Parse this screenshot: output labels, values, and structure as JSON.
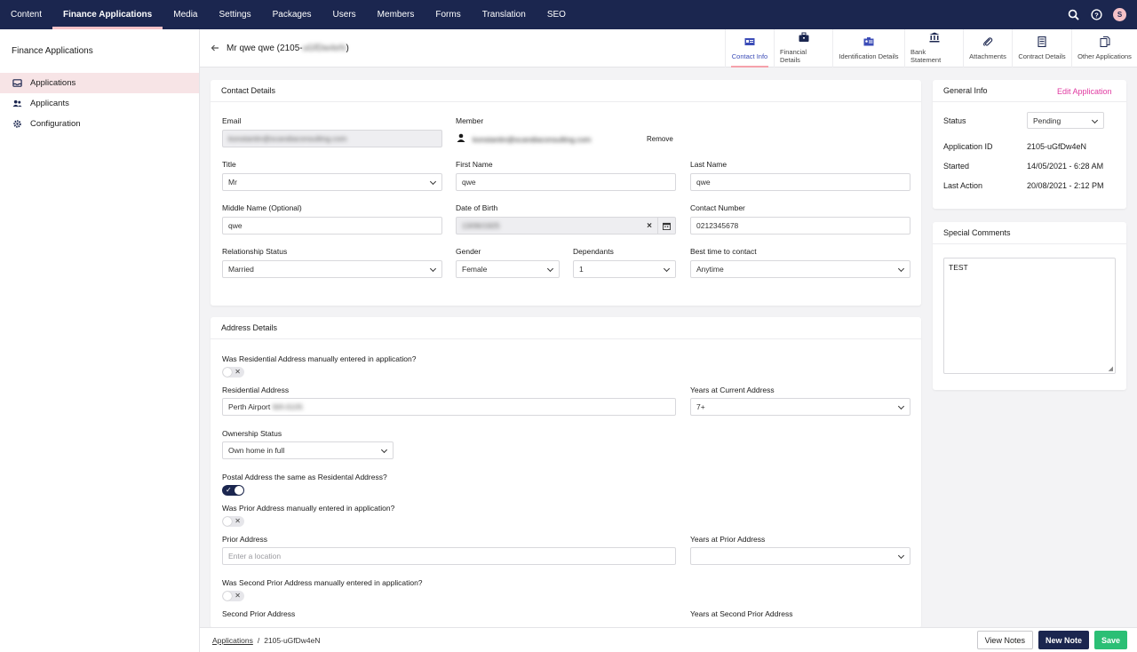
{
  "nav": {
    "tabs": [
      "Content",
      "Finance Applications",
      "Media",
      "Settings",
      "Packages",
      "Users",
      "Members",
      "Forms",
      "Translation",
      "SEO"
    ],
    "avatar": "S"
  },
  "sidebar": {
    "title": "Finance Applications",
    "items": [
      "Applications",
      "Applicants",
      "Configuration"
    ]
  },
  "header": {
    "title": "Mr qwe qwe (2105-",
    "title_blurred": "uGfDw4eN",
    "title_end": ")",
    "tabs": [
      "Contact Info",
      "Financial Details",
      "Identification Details",
      "Bank Statement",
      "Attachments",
      "Contract Details",
      "Other Applications"
    ]
  },
  "contact": {
    "heading": "Contact Details",
    "email_label": "Email",
    "email_value": "konstantin@scandiaconsulting.com",
    "member_label": "Member",
    "member_value": "konstantin@scandiaconsulting.com",
    "remove": "Remove",
    "title_label": "Title",
    "title_value": "Mr",
    "first_label": "First Name",
    "first_value": "qwe",
    "last_label": "Last Name",
    "last_value": "qwe",
    "middle_label": "Middle Name (Optional)",
    "middle_value": "qwe",
    "dob_label": "Date of Birth",
    "dob_value": "13/06/1925",
    "contact_label": "Contact Number",
    "contact_value": "0212345678",
    "rel_label": "Relationship Status",
    "rel_value": "Married",
    "gender_label": "Gender",
    "gender_value": "Female",
    "dep_label": "Dependants",
    "dep_value": "1",
    "best_label": "Best time to contact",
    "best_value": "Anytime"
  },
  "address": {
    "heading": "Address Details",
    "res_manual_label": "Was Residential Address manually entered in application?",
    "res_label": "Residential Address",
    "res_value": "Perth Airport",
    "res_value_blurred": "WA 6105",
    "years_cur_label": "Years at Current Address",
    "years_cur_value": "7+",
    "own_label": "Ownership Status",
    "own_value": "Own home in full",
    "postal_label": "Postal Address the same as Residental Address?",
    "prior_manual_label": "Was Prior Address manually entered in application?",
    "prior_label": "Prior Address",
    "prior_placeholder": "Enter a location",
    "years_prior_label": "Years at Prior Address",
    "second_manual_label": "Was Second Prior Address manually entered in application?",
    "second_label": "Second Prior Address",
    "years_second_label": "Years at Second Prior Address"
  },
  "general": {
    "heading": "General Info",
    "edit": "Edit Application",
    "status_label": "Status",
    "status_value": "Pending",
    "appid_label": "Application ID",
    "appid_value": "2105-uGfDw4eN",
    "started_label": "Started",
    "started_value": "14/05/2021 - 6:28 AM",
    "last_label": "Last Action",
    "last_value": "20/08/2021 - 2:12 PM"
  },
  "comments": {
    "heading": "Special Comments",
    "value": "TEST"
  },
  "footer": {
    "crumb_link": "Applications",
    "crumb_sep": "/",
    "crumb_current": "2105-uGfDw4eN",
    "view_notes": "View Notes",
    "new_note": "New Note",
    "save": "Save"
  },
  "colors": {
    "nav_bg": "#1b264f",
    "accent_pink": "#f5c1c7",
    "edit_link": "#e03aa1",
    "save_green": "#2bbf75"
  }
}
